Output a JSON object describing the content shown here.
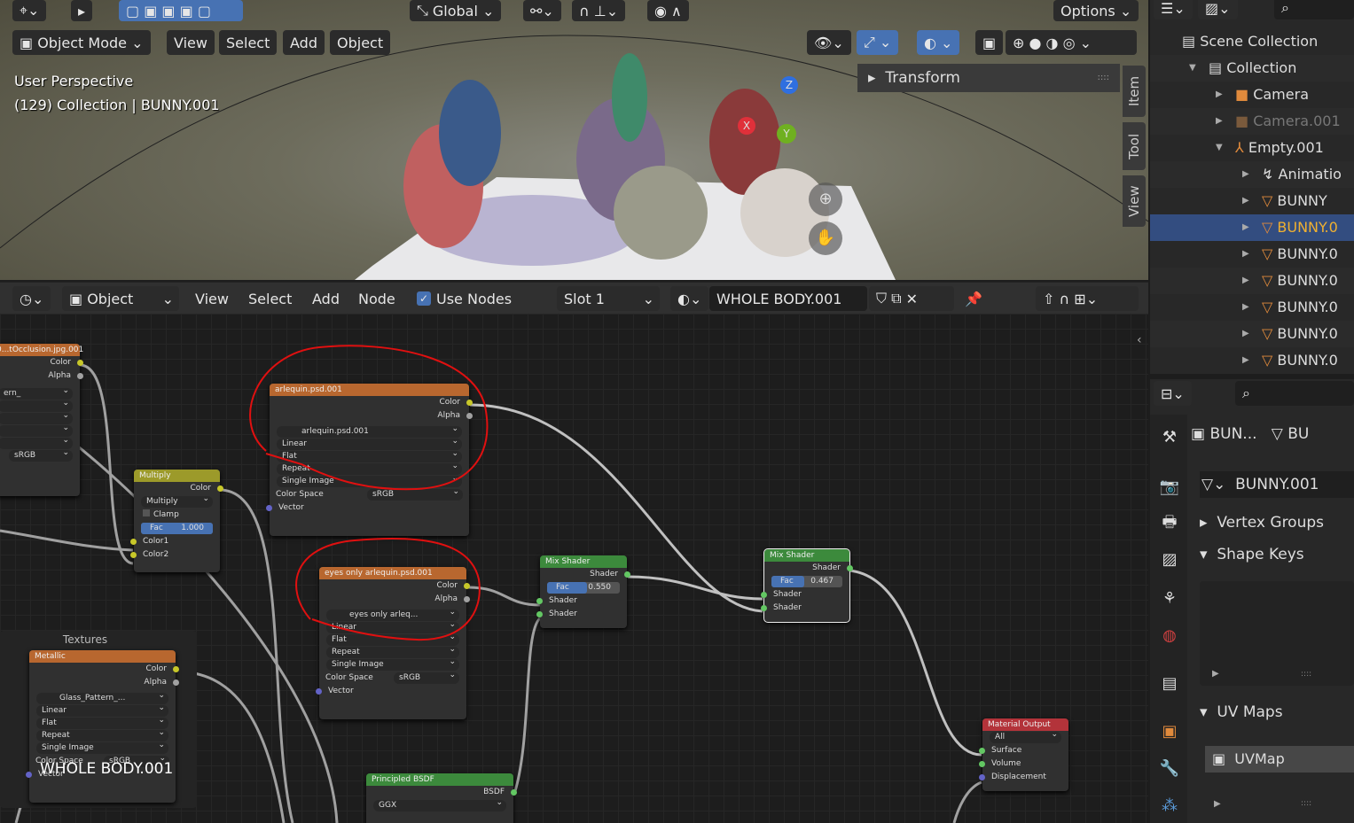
{
  "viewport": {
    "header": {
      "transform_orientation": "Global",
      "options": "Options"
    },
    "mode": "Object Mode",
    "menus": [
      "View",
      "Select",
      "Add",
      "Object"
    ],
    "overlay_text": [
      "User Perspective",
      "(129) Collection | BUNNY.001"
    ],
    "transform_panel": "Transform",
    "side_tabs": [
      "Item",
      "Tool",
      "View"
    ],
    "gizmo_axes": [
      "X",
      "Y",
      "Z"
    ]
  },
  "node_header": {
    "editor_type": "Object",
    "menus": [
      "View",
      "Select",
      "Add",
      "Node"
    ],
    "use_nodes": "Use Nodes",
    "use_nodes_checked": true,
    "slot": "Slot 1",
    "material": "WHOLE BODY.001"
  },
  "nodes": {
    "occlusion": {
      "title": "0...tOcclusion.jpg.001",
      "outputs": [
        "Color",
        "Alpha"
      ],
      "image": "ern_",
      "color_space": "sRGB"
    },
    "multiply": {
      "title": "Multiply",
      "output": "Color",
      "blend": "Multiply",
      "clamp": "Clamp",
      "fac_label": "Fac",
      "fac": "1.000",
      "fac_value": 1.0,
      "inputs": [
        "Color1",
        "Color2"
      ]
    },
    "arlequin": {
      "title": "arlequin.psd.001",
      "outputs": [
        "Color",
        "Alpha"
      ],
      "image": "arlequin.psd.001",
      "interpolation": "Linear",
      "projection": "Flat",
      "extension": "Repeat",
      "source": "Single Image",
      "color_space_label": "Color Space",
      "color_space": "sRGB",
      "input": "Vector"
    },
    "eyes": {
      "title": "eyes only arlequin.psd.001",
      "outputs": [
        "Color",
        "Alpha"
      ],
      "image": "eyes only arleq...",
      "interpolation": "Linear",
      "projection": "Flat",
      "extension": "Repeat",
      "source": "Single Image",
      "color_space_label": "Color Space",
      "color_space": "sRGB",
      "input": "Vector"
    },
    "mix1": {
      "title": "Mix Shader",
      "output": "Shader",
      "fac_label": "Fac",
      "fac": "0.550",
      "fac_value": 0.55,
      "inputs": [
        "Shader",
        "Shader"
      ]
    },
    "mix2": {
      "title": "Mix Shader",
      "output": "Shader",
      "fac_label": "Fac",
      "fac": "0.467",
      "fac_value": 0.467,
      "inputs": [
        "Shader",
        "Shader"
      ]
    },
    "frame": {
      "label": "Textures"
    },
    "metallic": {
      "title": "Metallic",
      "outputs": [
        "Color",
        "Alpha"
      ],
      "image": "Glass_Pattern_...",
      "interpolation": "Linear",
      "projection": "Flat",
      "extension": "Repeat",
      "source": "Single Image",
      "color_space_label": "Color Space",
      "color_space": "sRGB",
      "input": "Vector"
    },
    "principled": {
      "title": "Principled BSDF",
      "output": "BSDF",
      "distribution": "GGX"
    },
    "output": {
      "title": "Material Output",
      "target": "All",
      "inputs": [
        "Surface",
        "Volume",
        "Displacement"
      ]
    },
    "overlay_label": "WHOLE BODY.001"
  },
  "outliner": {
    "items": [
      {
        "label": "Scene Collection"
      },
      {
        "label": "Collection"
      },
      {
        "label": "Camera"
      },
      {
        "label": "Camera.001"
      },
      {
        "label": "Empty.001"
      },
      {
        "label": "Animatio"
      },
      {
        "label": "BUNNY"
      },
      {
        "label": "BUNNY.0",
        "selected": true
      },
      {
        "label": "BUNNY.0"
      },
      {
        "label": "BUNNY.0"
      },
      {
        "label": "BUNNY.0"
      },
      {
        "label": "BUNNY.0"
      },
      {
        "label": "BUNNY.0"
      }
    ]
  },
  "properties": {
    "breadcrumb": [
      "BUN...",
      "BU"
    ],
    "mesh_name": "BUNNY.001",
    "panels": [
      "Vertex Groups",
      "Shape Keys",
      "UV Maps"
    ],
    "uv_map": "UVMap"
  },
  "colors": {
    "accent": "#4772b3",
    "annotation": "#e01010",
    "texture_header": "#b8672f",
    "shader_header": "#3c8a3c",
    "output_header": "#b3333a",
    "mix_header": "#9c9a2a"
  }
}
